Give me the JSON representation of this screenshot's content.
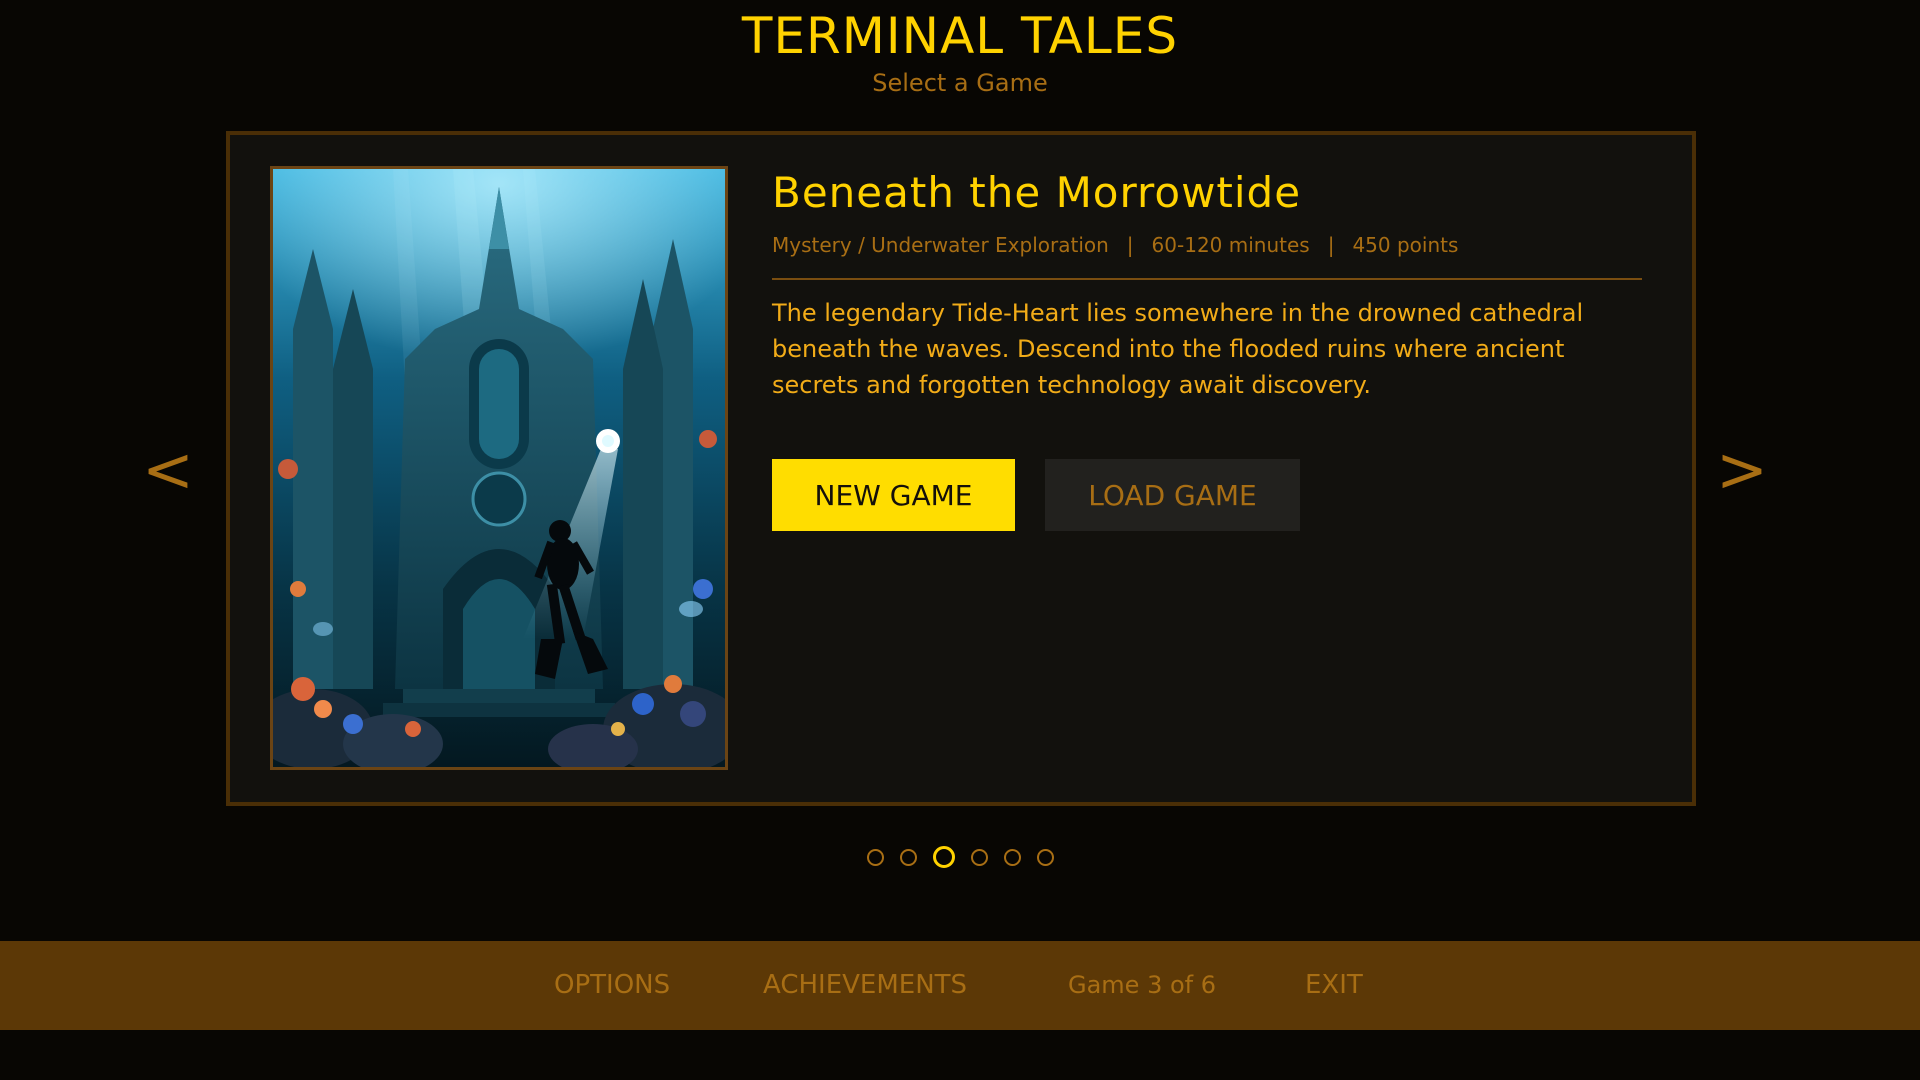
{
  "app": {
    "title": "TERMINAL TALES",
    "subtitle": "Select a Game"
  },
  "game": {
    "title": "Beneath the Morrowtide",
    "genre": "Mystery / Underwater Exploration",
    "duration": "60-120 minutes",
    "points": "450 points",
    "separator": "|",
    "description": "The legendary Tide-Heart lies somewhere in the drowned cathedral beneath the waves. Descend into the flooded ruins where ancient secrets and forgotten technology await discovery.",
    "cover_icon": "underwater-cathedral-diver-image"
  },
  "actions": {
    "new_game": "NEW GAME",
    "load_game": "LOAD GAME"
  },
  "nav": {
    "prev": "<",
    "next": ">"
  },
  "pagination": {
    "total": 6,
    "current": 3
  },
  "bottom_bar": {
    "options": "OPTIONS",
    "achievements": "ACHIEVEMENTS",
    "counter": "Game 3 of 6",
    "exit": "EXIT"
  },
  "colors": {
    "background": "#080603",
    "accent": "#ffd200",
    "muted": "#a86e14",
    "bar": "#5c3806",
    "new_game_button": "#ffdd00",
    "load_game_button": "#22211e"
  }
}
